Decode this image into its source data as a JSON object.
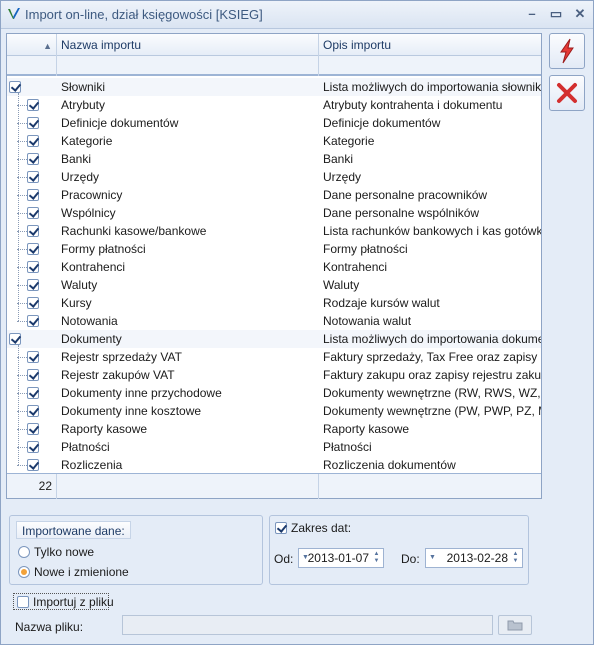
{
  "window": {
    "title": "Import on-line, dział księgowości [KSIEG]"
  },
  "grid": {
    "columns": [
      "",
      "Nazwa importu",
      "Opis importu"
    ],
    "sort_indicator": "▲",
    "count": "22",
    "rows": [
      {
        "level": 0,
        "checked": true,
        "name": "Słowniki",
        "desc": "Lista możliwych do importowania słowników"
      },
      {
        "level": 1,
        "checked": true,
        "name": "Atrybuty",
        "desc": "Atrybuty kontrahenta i dokumentu"
      },
      {
        "level": 1,
        "checked": true,
        "name": "Definicje dokumentów",
        "desc": "Definicje dokumentów"
      },
      {
        "level": 1,
        "checked": true,
        "name": "Kategorie",
        "desc": "Kategorie"
      },
      {
        "level": 1,
        "checked": true,
        "name": "Banki",
        "desc": "Banki"
      },
      {
        "level": 1,
        "checked": true,
        "name": "Urzędy",
        "desc": "Urzędy"
      },
      {
        "level": 1,
        "checked": true,
        "name": "Pracownicy",
        "desc": "Dane personalne pracowników"
      },
      {
        "level": 1,
        "checked": true,
        "name": "Wspólnicy",
        "desc": "Dane personalne wspólników"
      },
      {
        "level": 1,
        "checked": true,
        "name": "Rachunki kasowe/bankowe",
        "desc": "Lista rachunków bankowych i kas gotówko..."
      },
      {
        "level": 1,
        "checked": true,
        "name": "Formy płatności",
        "desc": "Formy płatności"
      },
      {
        "level": 1,
        "checked": true,
        "name": "Kontrahenci",
        "desc": "Kontrahenci"
      },
      {
        "level": 1,
        "checked": true,
        "name": "Waluty",
        "desc": "Waluty"
      },
      {
        "level": 1,
        "checked": true,
        "name": "Kursy",
        "desc": "Rodzaje kursów walut"
      },
      {
        "level": 1,
        "checked": true,
        "name": "Notowania",
        "desc": "Notowania walut"
      },
      {
        "level": 0,
        "checked": true,
        "name": "Dokumenty",
        "desc": "Lista możliwych do importowania dokumen..."
      },
      {
        "level": 1,
        "checked": true,
        "name": "Rejestr sprzedaży VAT",
        "desc": "Faktury sprzedaży, Tax Free oraz zapisy r..."
      },
      {
        "level": 1,
        "checked": true,
        "name": "Rejestr zakupów VAT",
        "desc": "Faktury zakupu oraz zapisy rejestru zakup..."
      },
      {
        "level": 1,
        "checked": true,
        "name": "Dokumenty inne przychodowe",
        "desc": "Dokumenty wewnętrzne (RW, RWS, WZ, ..."
      },
      {
        "level": 1,
        "checked": true,
        "name": "Dokumenty inne kosztowe",
        "desc": "Dokumenty wewnętrzne (PW, PWP, PZ, M..."
      },
      {
        "level": 1,
        "checked": true,
        "name": "Raporty kasowe",
        "desc": "Raporty kasowe"
      },
      {
        "level": 1,
        "checked": true,
        "name": "Płatności",
        "desc": "Płatności"
      },
      {
        "level": 1,
        "checked": true,
        "name": "Rozliczenia",
        "desc": "Rozliczenia dokumentów"
      }
    ]
  },
  "import_group": {
    "title": "Importowane dane:",
    "options": [
      "Tylko nowe",
      "Nowe i zmienione"
    ],
    "selected": 1
  },
  "date_group": {
    "checkbox_label": "Zakres dat:",
    "checked": true,
    "from_label": "Od:",
    "from_value": "2013-01-07",
    "to_label": "Do:",
    "to_value": "2013-02-28"
  },
  "file": {
    "checkbox_label": "Importuj z pliku",
    "checked": false,
    "name_label": "Nazwa pliku:",
    "name_value": ""
  },
  "colors": {
    "accent": "#1e3b66",
    "run": "#d93025",
    "cancel": "#d32f2f"
  }
}
